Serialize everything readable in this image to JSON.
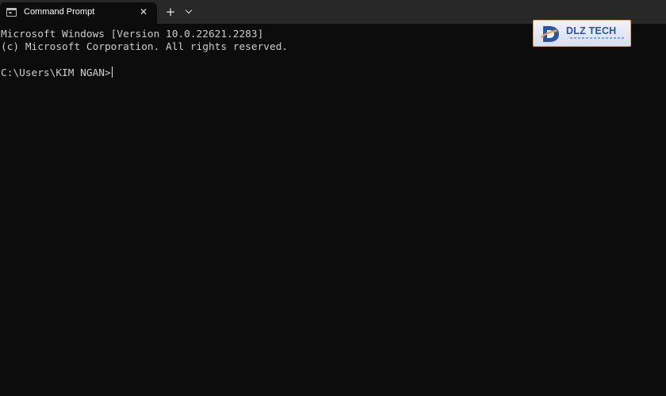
{
  "window": {
    "tab_title": "Command Prompt",
    "tab_icon": "terminal-icon",
    "close_icon": "close-icon",
    "new_tab_icon": "plus-icon",
    "dropdown_icon": "chevron-down-icon"
  },
  "glyphs": {
    "close": "✕",
    "plus": "+"
  },
  "console": {
    "line1": "Microsoft Windows [Version 10.0.22621.2283]",
    "line2": "(c) Microsoft Corporation. All rights reserved.",
    "prompt": "C:\\Users\\KIM NGAN>"
  },
  "watermark": {
    "brand": "DLZ TECH"
  },
  "colors": {
    "background": "#0c0c0c",
    "titlebar": "#282828",
    "text": "#cccccc",
    "logo_border": "#f0a53a",
    "logo_text": "#2a54a8"
  }
}
